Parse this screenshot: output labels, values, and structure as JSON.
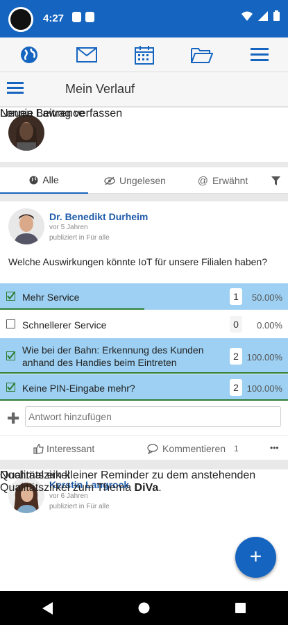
{
  "status": {
    "time": "4:27"
  },
  "header": {
    "title": "Mein Verlauf"
  },
  "composer": {
    "name": "Lonnie Lawrence",
    "prompt": "Neuen Beitrag verfassen"
  },
  "filters": {
    "all": "Alle",
    "unread": "Ungelesen",
    "mentioned": "Erwähnt"
  },
  "post1": {
    "author": "Dr. Benedikt Durheim",
    "time": "vor 5 Jahren",
    "published": "publiziert in Für alle",
    "question": "Welche Auswirkungen könnte IoT für unsere Filialen haben?",
    "options": [
      {
        "label": "Mehr Service",
        "count": "1",
        "percent": "50.00%",
        "checked": true,
        "fill": 0.5
      },
      {
        "label": "Schnellerer Service",
        "count": "0",
        "percent": "0.00%",
        "checked": false,
        "fill": 0
      },
      {
        "label": "Wie bei der Bahn: Erkennung des Kunden anhand des Handies beim Eintreten",
        "count": "2",
        "percent": "100.00%",
        "checked": true,
        "fill": 1
      },
      {
        "label": "Keine PIN-Eingabe mehr?",
        "count": "2",
        "percent": "100.00%",
        "checked": true,
        "fill": 1
      }
    ],
    "answer_placeholder": "Antwort hinzufügen",
    "like_label": "Interessant",
    "comment_label": "Kommentieren",
    "comment_count": "1",
    "more": "•••"
  },
  "post2": {
    "author": "Kerstin Langrock",
    "time": "vor 6 Jahren",
    "published": "publiziert in Für alle",
    "heading": "Qualitätszirkel",
    "body_prefix": "Nochmal ein kleiner Reminder zu dem anstehenden Qualitätszirkel zum Thema ",
    "body_bold": "DiVa",
    "body_suffix": "."
  },
  "fab": {
    "label": "+"
  },
  "colors": {
    "primary": "#1565c0",
    "poll_fill": "#9dd0f2",
    "poll_bar": "#2e7d32",
    "link": "#1e5aa8"
  }
}
